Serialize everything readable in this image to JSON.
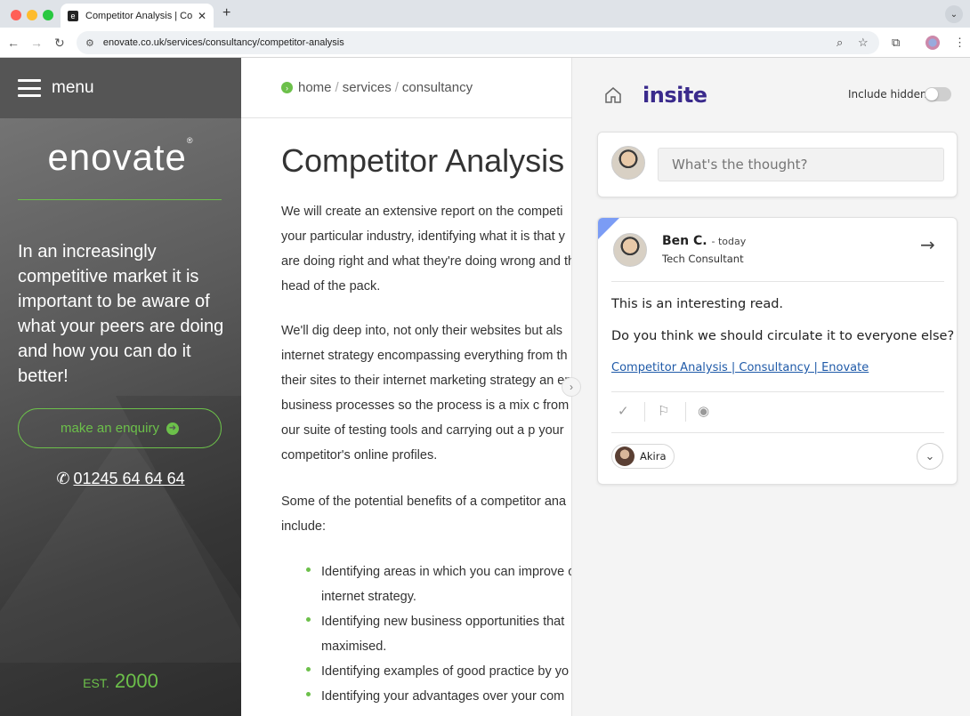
{
  "browser": {
    "tab_title": "Competitor Analysis | Consult",
    "tab_favicon": "e",
    "url": "enovate.co.uk/services/consultancy/competitor-analysis",
    "colors": {
      "close": "#ff5f57",
      "minimize": "#febc2e",
      "maximize": "#28c840"
    }
  },
  "site": {
    "menu_label": "menu",
    "logo": "enovate",
    "logo_mark": "®",
    "tagline": "In an increasingly competitive market it is important to be aware of what your peers are doing and how you can do it better!",
    "enquiry_label": "make an enquiry",
    "phone": "01245 64 64 64",
    "est_prefix": "EST.",
    "est_year": "2000",
    "accent": "#6cc04a"
  },
  "breadcrumb": {
    "home": "home",
    "services": "services",
    "consultancy": "consultancy",
    "separator": "/"
  },
  "page": {
    "title": "Competitor Analysis",
    "para1": "We will create an extensive report on the competi your particular industry, identifying what it is that y are doing right and what they're doing wrong and the head of the pack.",
    "para2": "We'll dig deep into, not only their websites but als internet strategy encompassing everything from th their sites to their internet marketing strategy an end business processes so the process is a mix c from our suite of testing tools and carrying out a p your competitor's online profiles.",
    "para3": "Some of the potential benefits of a competitor ana include:",
    "bullets": [
      "Identifying areas in which you can improve or internet strategy.",
      "Identifying new business opportunities that maximised.",
      "Identifying examples of good practice by yo",
      "Identifying your advantages over your com"
    ]
  },
  "insite": {
    "brand": "insite",
    "include_hidden_label": "Include hidden",
    "include_hidden_on": false,
    "compose_placeholder": "What's the thought?",
    "post": {
      "author": "Ben C.",
      "when": "- today",
      "role": "Tech Consultant",
      "line1": "This is an interesting read.",
      "line2": "Do you think we should circulate it to everyone else?",
      "link_text": "Competitor Analysis | Consultancy | Enovate",
      "mention": "Akira",
      "accent": "#7b9cf5"
    }
  }
}
